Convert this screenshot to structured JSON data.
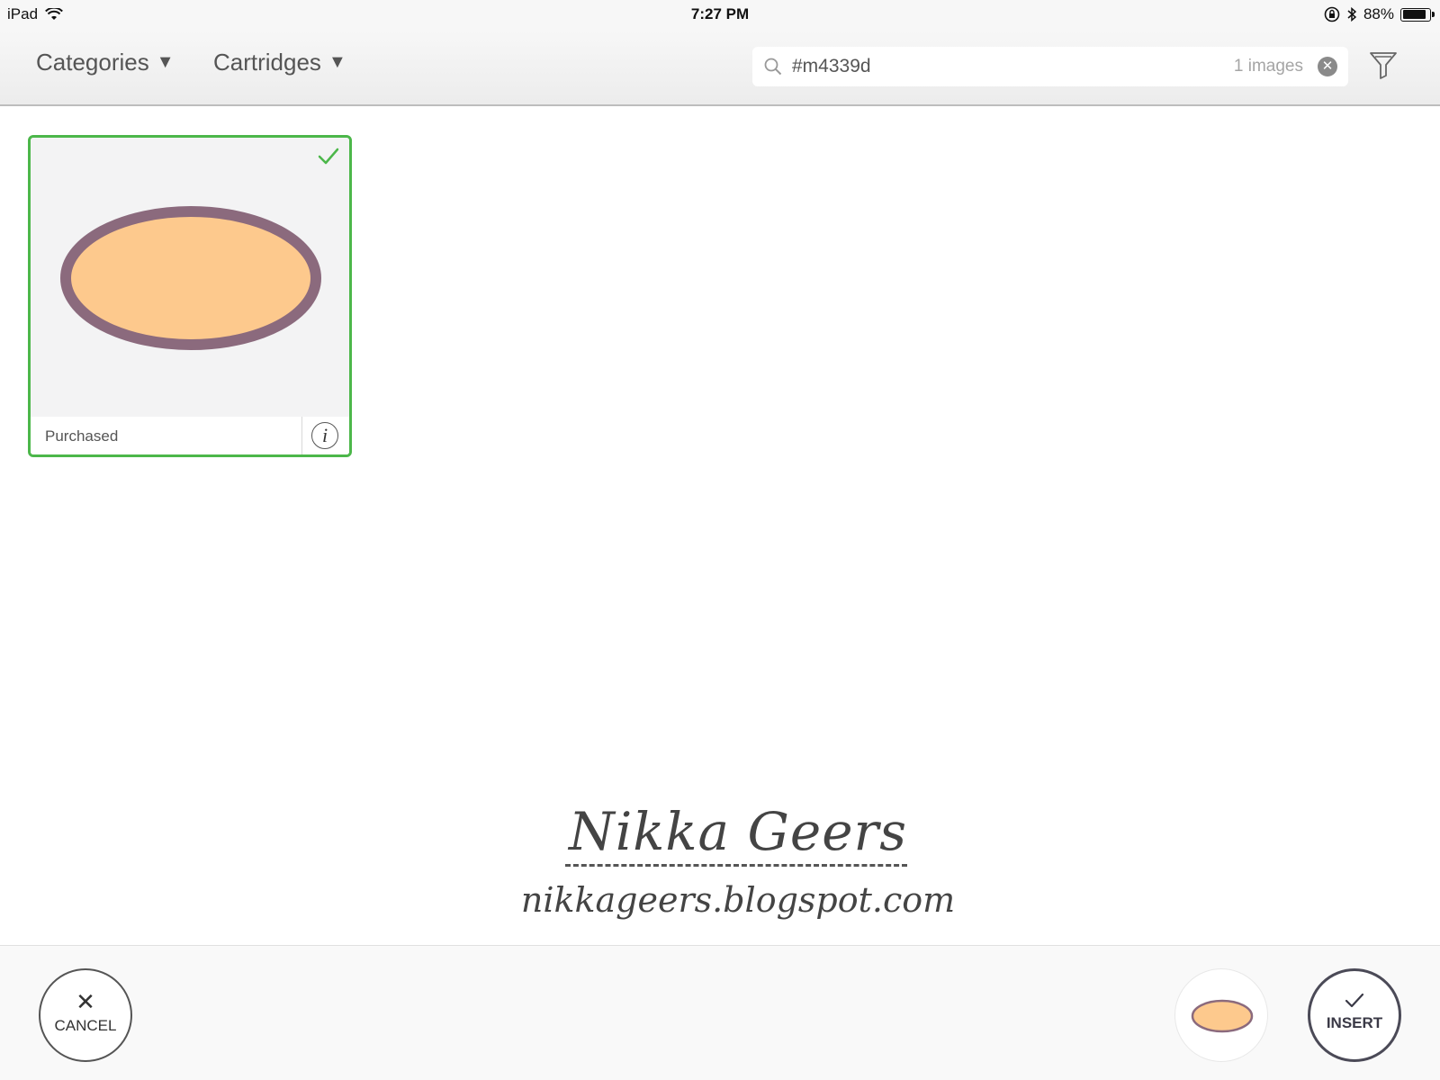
{
  "status_bar": {
    "device": "iPad",
    "time": "7:27 PM",
    "battery": "88%",
    "battery_level": 0.88
  },
  "toolbar": {
    "categories_label": "Categories",
    "cartridges_label": "Cartridges",
    "search_value": "#m4339d",
    "search_count": "1 images"
  },
  "results": [
    {
      "status": "Purchased",
      "selected": true,
      "fill_color": "#fdc98d",
      "stroke_color": "#8b6a7d"
    }
  ],
  "watermark": {
    "name": "Nikka Geers",
    "url": "nikkageers.blogspot.com"
  },
  "bottom_bar": {
    "cancel_label": "CANCEL",
    "insert_label": "INSERT"
  },
  "colors": {
    "selected_border": "#4cb74a",
    "insert_border": "#4b4a57"
  }
}
